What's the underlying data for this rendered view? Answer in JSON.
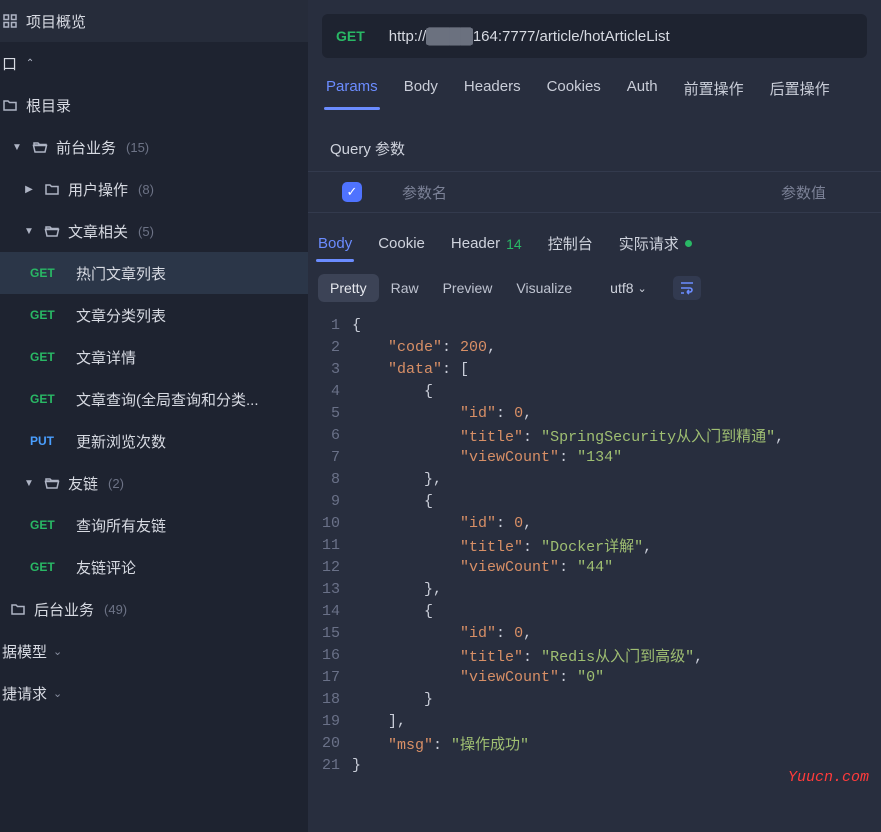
{
  "sidebar": {
    "overview": "项目概览",
    "interface_section": "口",
    "root": "根目录",
    "groups": [
      {
        "label": "前台业务",
        "count": "(15)",
        "expanded": true,
        "children": [
          {
            "label": "用户操作",
            "count": "(8)",
            "type": "folder",
            "expanded": false
          },
          {
            "label": "文章相关",
            "count": "(5)",
            "type": "folder",
            "expanded": true,
            "children": [
              {
                "method": "GET",
                "label": "热门文章列表",
                "active": true
              },
              {
                "method": "GET",
                "label": "文章分类列表"
              },
              {
                "method": "GET",
                "label": "文章详情"
              },
              {
                "method": "GET",
                "label": "文章查询(全局查询和分类..."
              },
              {
                "method": "PUT",
                "label": "更新浏览次数"
              }
            ]
          },
          {
            "label": "友链",
            "count": "(2)",
            "type": "folder",
            "expanded": true,
            "children": [
              {
                "method": "GET",
                "label": "查询所有友链"
              },
              {
                "method": "GET",
                "label": "友链评论"
              }
            ]
          }
        ]
      },
      {
        "label": "后台业务",
        "count": "(49)",
        "type": "folder"
      }
    ],
    "data_model": "据模型",
    "quick_request": "捷请求"
  },
  "request": {
    "method": "GET",
    "url_prefix": "http://",
    "url_masked": "████",
    "url_suffix": "164:7777/article/hotArticleList"
  },
  "req_tabs": [
    "Params",
    "Body",
    "Headers",
    "Cookies",
    "Auth",
    "前置操作",
    "后置操作"
  ],
  "req_tabs_active": 0,
  "query_section_title": "Query 参数",
  "param_headers": {
    "name": "参数名",
    "value": "参数值"
  },
  "resp_tabs": [
    {
      "label": "Body",
      "active": true
    },
    {
      "label": "Cookie"
    },
    {
      "label": "Header",
      "count": "14"
    },
    {
      "label": "控制台"
    },
    {
      "label": "实际请求",
      "dot": true
    }
  ],
  "view_modes": [
    "Pretty",
    "Raw",
    "Preview",
    "Visualize"
  ],
  "view_mode_active": 0,
  "encoding": "utf8",
  "response_json": {
    "code": 200,
    "data": [
      {
        "id": 0,
        "title": "SpringSecurity从入门到精通",
        "viewCount": "134"
      },
      {
        "id": 0,
        "title": "Docker详解",
        "viewCount": "44"
      },
      {
        "id": 0,
        "title": "Redis从入门到高级",
        "viewCount": "0"
      }
    ],
    "msg": "操作成功"
  },
  "watermark": "Yuucn.com"
}
